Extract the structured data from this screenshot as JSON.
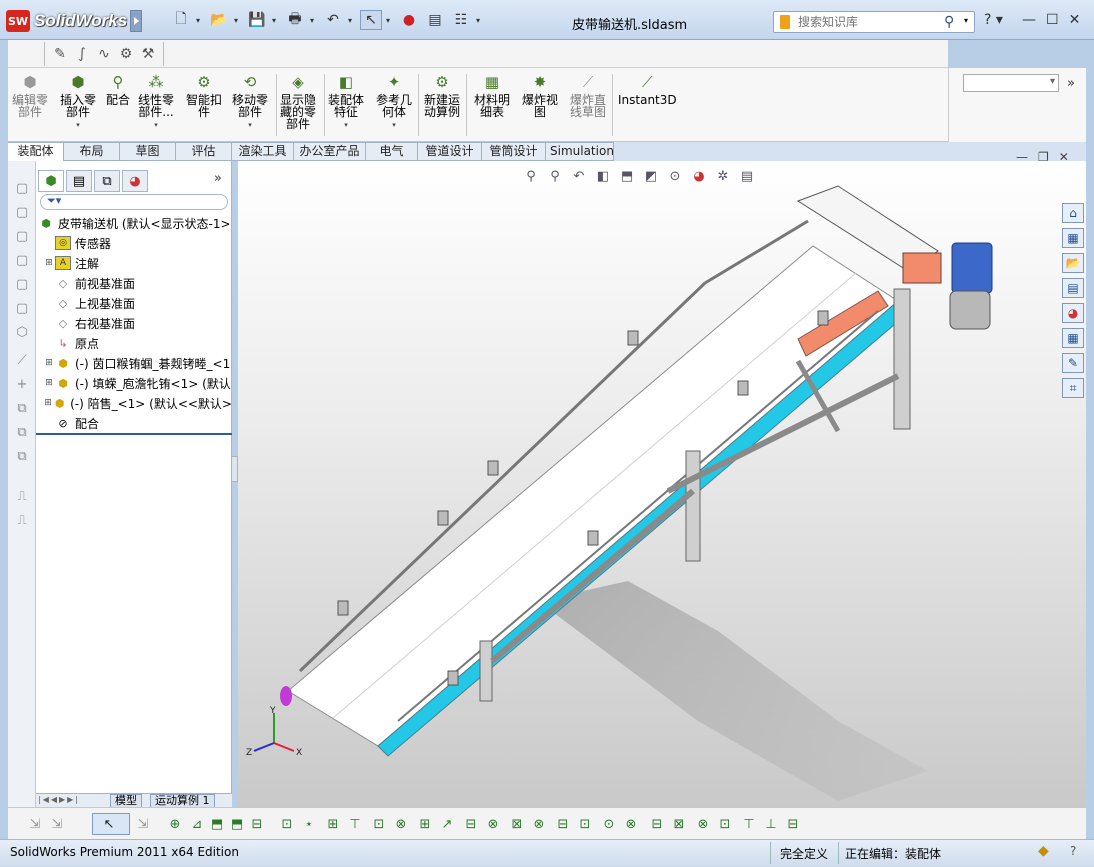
{
  "app": {
    "brand": "SolidWorks",
    "brand_badge": "SW",
    "document_title": "皮带输送机.sldasm",
    "search_placeholder": "搜索知识库"
  },
  "command_manager": [
    {
      "label": "编辑零\n部件",
      "icon": "edit-component-icon",
      "disabled": true
    },
    {
      "label": "插入零\n部件",
      "icon": "insert-component-icon",
      "arrow": true
    },
    {
      "label": "配合",
      "icon": "mate-icon"
    },
    {
      "label": "线性零\n部件...",
      "icon": "linear-pattern-icon",
      "arrow": true
    },
    {
      "label": "智能扣\n件",
      "icon": "smart-fastener-icon"
    },
    {
      "label": "移动零\n部件",
      "icon": "move-component-icon",
      "arrow": true
    },
    {
      "label": "显示隐\n藏的零\n部件",
      "icon": "show-hidden-icon"
    },
    {
      "label": "装配体\n特征",
      "icon": "assembly-feature-icon",
      "arrow": true
    },
    {
      "label": "参考几\n何体",
      "icon": "reference-geometry-icon",
      "arrow": true
    },
    {
      "label": "新建运\n动算例",
      "icon": "new-motion-study-icon"
    },
    {
      "label": "材料明\n细表",
      "icon": "bom-icon"
    },
    {
      "label": "爆炸视\n图",
      "icon": "explode-view-icon"
    },
    {
      "label": "爆炸直\n线草图",
      "icon": "explode-line-sketch-icon",
      "disabled": true
    },
    {
      "label": "Instant3D",
      "icon": "instant3d-icon"
    }
  ],
  "tabs": [
    "装配体",
    "布局",
    "草图",
    "评估",
    "渲染工具",
    "办公室产品",
    "电气",
    "管道设计",
    "管筒设计",
    "Simulation"
  ],
  "active_tab": "装配体",
  "feature_tree": {
    "root": "皮带输送机 (默认<显示状态-1>",
    "items": [
      {
        "label": "传感器",
        "icon": "sensor-icon",
        "expandable": false
      },
      {
        "label": "注解",
        "icon": "annotation-icon",
        "expandable": true
      },
      {
        "label": "前视基准面",
        "icon": "plane-icon",
        "expandable": false
      },
      {
        "label": "上视基准面",
        "icon": "plane-icon",
        "expandable": false
      },
      {
        "label": "右视基准面",
        "icon": "plane-icon",
        "expandable": false
      },
      {
        "label": "原点",
        "icon": "origin-icon",
        "expandable": false
      },
      {
        "label": "(-) 茵口糇铕蝈_碁觌铐畻_<1",
        "icon": "part-icon",
        "expandable": true
      },
      {
        "label": "(-) 填蝾_庖澹牝铕<1> (默认",
        "icon": "part-icon",
        "expandable": true
      },
      {
        "label": "(-) 陪售_<1> (默认<<默认>",
        "icon": "part-icon",
        "expandable": true
      },
      {
        "label": "配合",
        "icon": "mates-folder-icon",
        "expandable": false
      }
    ]
  },
  "bottom_tabs": [
    "模型",
    "运动算例 1"
  ],
  "status": {
    "edition": "SolidWorks Premium 2011 x64 Edition",
    "definition": "完全定义",
    "editing": "正在编辑：装配体"
  }
}
